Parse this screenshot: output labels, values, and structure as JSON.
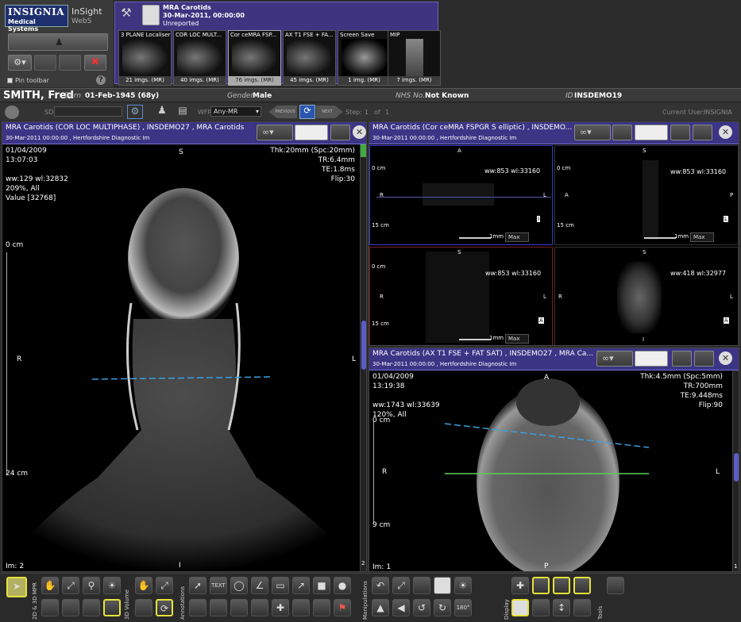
{
  "logo": {
    "line1": "INSIGNIA",
    "line2": "Medical Systems",
    "product": "InSight",
    "product_sub": "WebS"
  },
  "pin_toolbar": "Pin toolbar",
  "help": "?",
  "study": {
    "title": "MRA Carotids",
    "datetime": "30-Mar-2011, 00:00:00",
    "status": "Unreported"
  },
  "series": [
    {
      "name": "3 PLANE Localiser",
      "count": "21 imgs. (MR)"
    },
    {
      "name": "COR LOC MULT...",
      "count": "40 imgs. (MR)"
    },
    {
      "name": "Cor ceMRA FSP...",
      "count": "76 imgs. (MR)"
    },
    {
      "name": "AX T1 FSE + FA...",
      "count": "45 imgs. (MR)"
    },
    {
      "name": "Screen Save",
      "count": "1 img. (MR)"
    },
    {
      "name": "MIP",
      "count": "7 imgs. (MR)"
    }
  ],
  "patient": {
    "name": "SMITH, Fred",
    "born_label": "Born",
    "born": "01-Feb-1945 (68y)",
    "gender_label": "Gender",
    "gender": "Male",
    "nhs_label": "NHS No.",
    "nhs": "Not Known",
    "id_label": "ID",
    "id": "INSDEMO19"
  },
  "toolbar": {
    "sd": "SD",
    "wfp_label": "WFP",
    "wfp_value": "Any-MR",
    "previous": "PREVIOUS",
    "next": "NEXT",
    "step_label": "Step:",
    "step_value": "1",
    "of": "of",
    "step_total": "1",
    "current_user_label": "Current User:",
    "current_user": "INSIGNIA"
  },
  "vp1": {
    "title": "MRA Carotids  (COR LOC MULTIPHASE) , INSDEMO27 , MRA Carotids",
    "sub": "30-Mar-2011 00:00:00 , Hertfordshire Diagnostic Im",
    "date": "01/04/2009",
    "time": "13:07:03",
    "ww": "ww:129 wl:32832",
    "zoom": "209%, All",
    "value": "Value [32768]",
    "thk": "Thk:20mm (Spc:20mm)",
    "tr": "TR:6.4mm",
    "te": "TE:1.8ms",
    "flip": "Flip:30",
    "top": "S",
    "bottom": "I",
    "left": "R",
    "right": "L",
    "r0": "0 cm",
    "r24": "24 cm",
    "im": "Im: 2",
    "scroll": "2"
  },
  "vp2": {
    "title": "MRA Carotids  (Cor ceMRA FSPGR S elliptic) , INSDEMO...",
    "sub": "30-Mar-2011 00:00:00 , Hertfordshire Diagnostic Im",
    "cells": [
      {
        "top": "A",
        "left": "R",
        "right": "L",
        "ww": "ww:853 wl:33160",
        "r0": "0 cm",
        "r15": "15 cm",
        "thick": "1mm",
        "mode": "Max",
        "badge": "I"
      },
      {
        "top": "S",
        "left": "A",
        "right": "P",
        "ww": "ww:853 wl:33160",
        "r0": "0 cm",
        "r15": "15 cm",
        "thick": "1mm",
        "mode": "Max",
        "badge": "L"
      },
      {
        "top": "S",
        "left": "R",
        "right": "L",
        "ww": "ww:853 wl:33160",
        "r0": "0 cm",
        "r15": "15 cm",
        "thick": "1mm",
        "mode": "Max",
        "badge": "A"
      },
      {
        "top": "S",
        "left": "R",
        "right": "L",
        "ww": "ww:418 wl:32977",
        "bottom": "I",
        "badge": "A"
      }
    ]
  },
  "vp3": {
    "title": "MRA Carotids  (AX T1 FSE + FAT SAT) , INSDEMO27 , MRA Ca...",
    "sub": "30-Mar-2011 00:00:00 , Hertfordshire Diagnostic Im",
    "date": "01/04/2009",
    "time": "13:19:38",
    "ww": "ww:1743 wl:33639",
    "zoom": "120%, All",
    "thk": "Thk:4.5mm (Spc:5mm)",
    "tr": "TR:700mm",
    "te": "TE:9.448ms",
    "flip": "Flip:90",
    "top": "A",
    "bottom": "P",
    "left": "R",
    "right": "L",
    "r0": "0 cm",
    "r9": "9 cm",
    "im": "Im: 1",
    "scroll": "1"
  },
  "bottom": {
    "mpr": "2D & 3D MPR",
    "volume": "3D Volume",
    "annotations": "Annotations",
    "manipulations": "Manipulations",
    "display": "Display",
    "tools": "Tools",
    "text": "TEXT",
    "rot": "180°"
  },
  "colors": {
    "accent": "#3c3485",
    "highlight": "#e6e23a",
    "ref_line_blue": "#3aa0e0",
    "ref_line_green": "#5ad05a"
  }
}
